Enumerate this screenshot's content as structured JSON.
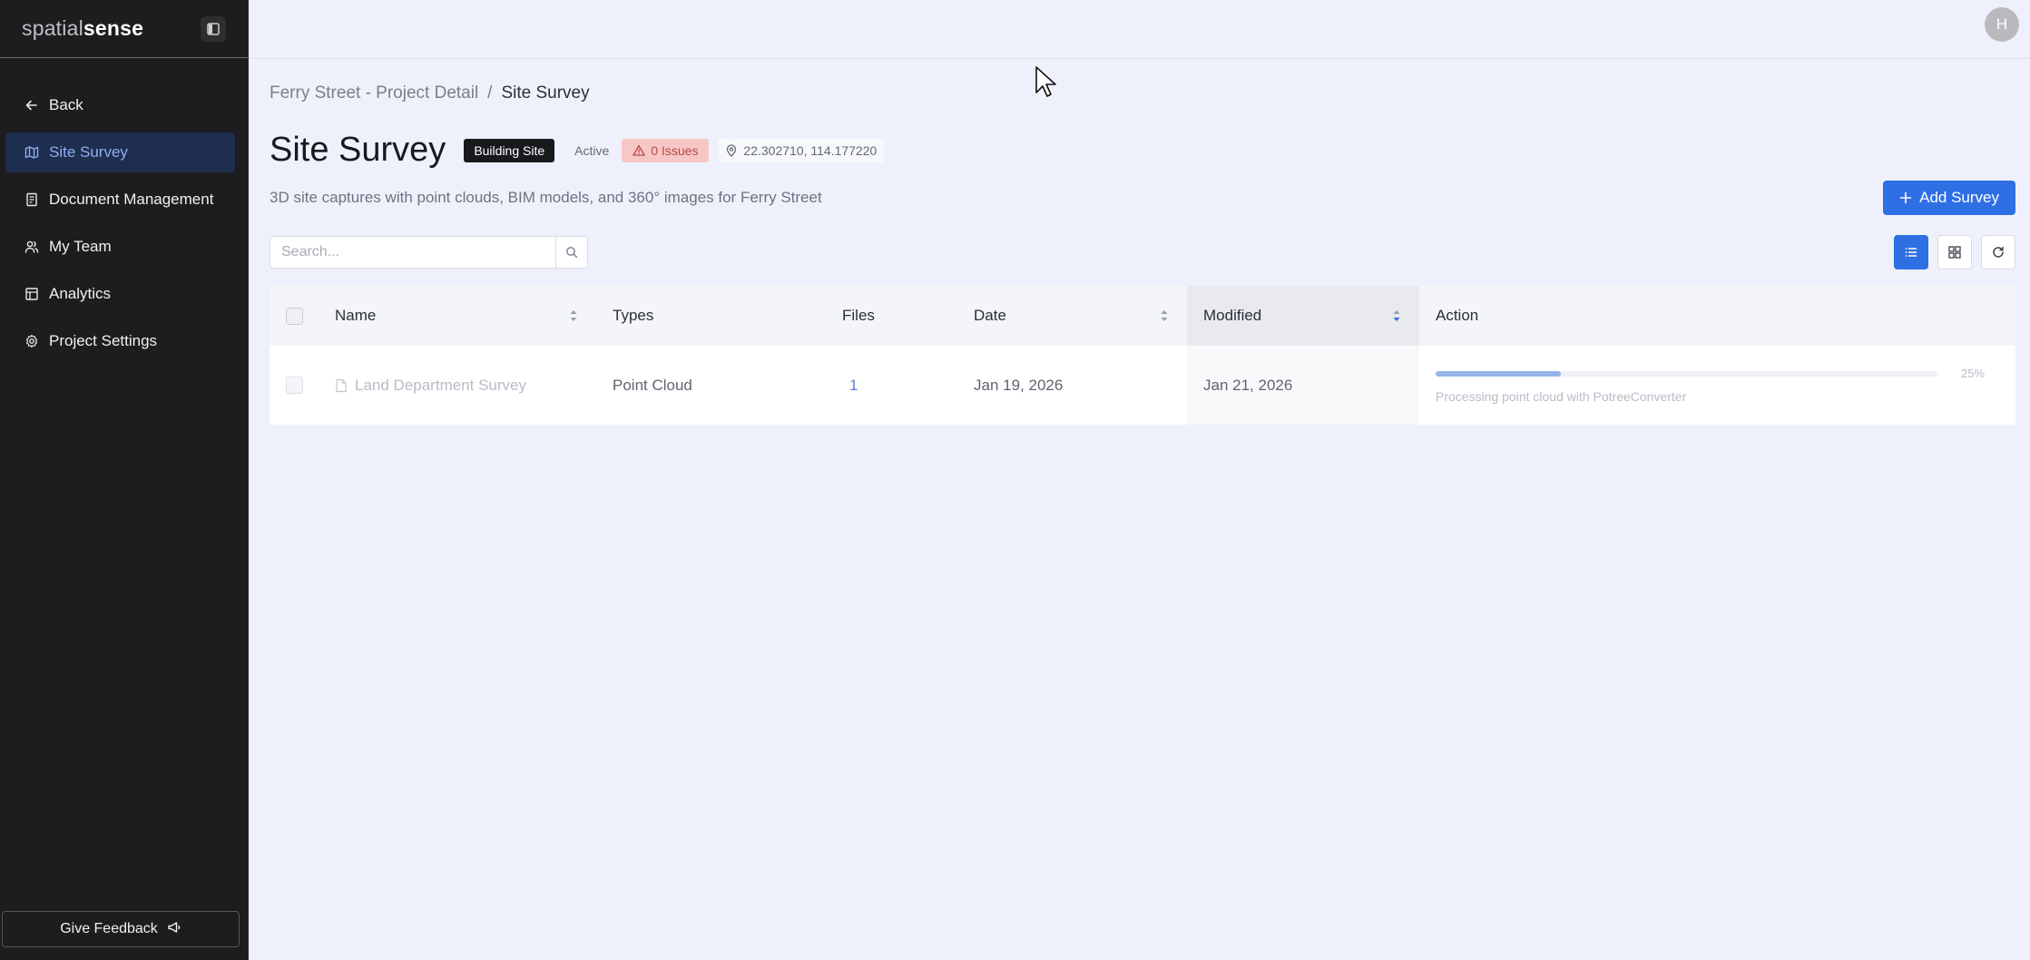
{
  "brand": {
    "light": "spatial",
    "bold": "sense"
  },
  "sidebar": {
    "items": [
      {
        "label": "Back",
        "icon": "arrow-left-icon"
      },
      {
        "label": "Site Survey",
        "icon": "map-icon"
      },
      {
        "label": "Document Management",
        "icon": "document-icon"
      },
      {
        "label": "My Team",
        "icon": "team-icon"
      },
      {
        "label": "Analytics",
        "icon": "analytics-icon"
      },
      {
        "label": "Project Settings",
        "icon": "gear-icon"
      }
    ],
    "feedback_label": "Give Feedback"
  },
  "user": {
    "initial": "H"
  },
  "breadcrumb": {
    "parent": "Ferry Street - Project Detail",
    "separator": "/",
    "current": "Site Survey"
  },
  "header": {
    "title": "Site Survey",
    "site_tag": "Building Site",
    "status": "Active",
    "issues": "0 Issues",
    "coordinates": "22.302710, 114.177220",
    "subtitle": "3D site captures with point clouds, BIM models, and 360° images for Ferry Street",
    "add_button": "Add Survey"
  },
  "search": {
    "placeholder": "Search..."
  },
  "table": {
    "columns": {
      "name": "Name",
      "types": "Types",
      "files": "Files",
      "date": "Date",
      "modified": "Modified",
      "action": "Action"
    },
    "rows": [
      {
        "name": "Land Department Survey",
        "types": "Point Cloud",
        "files": "1",
        "date": "Jan 19, 2026",
        "modified": "Jan 21, 2026",
        "progress_percent": 25,
        "progress_label": "25%",
        "progress_note": "Processing point cloud with PotreeConverter"
      }
    ]
  },
  "colors": {
    "accent": "#2f6fe4",
    "sidebar_bg": "#1d1d1f",
    "active_nav_bg": "#1e2e4f",
    "issues_bg": "#f6c7c5"
  }
}
